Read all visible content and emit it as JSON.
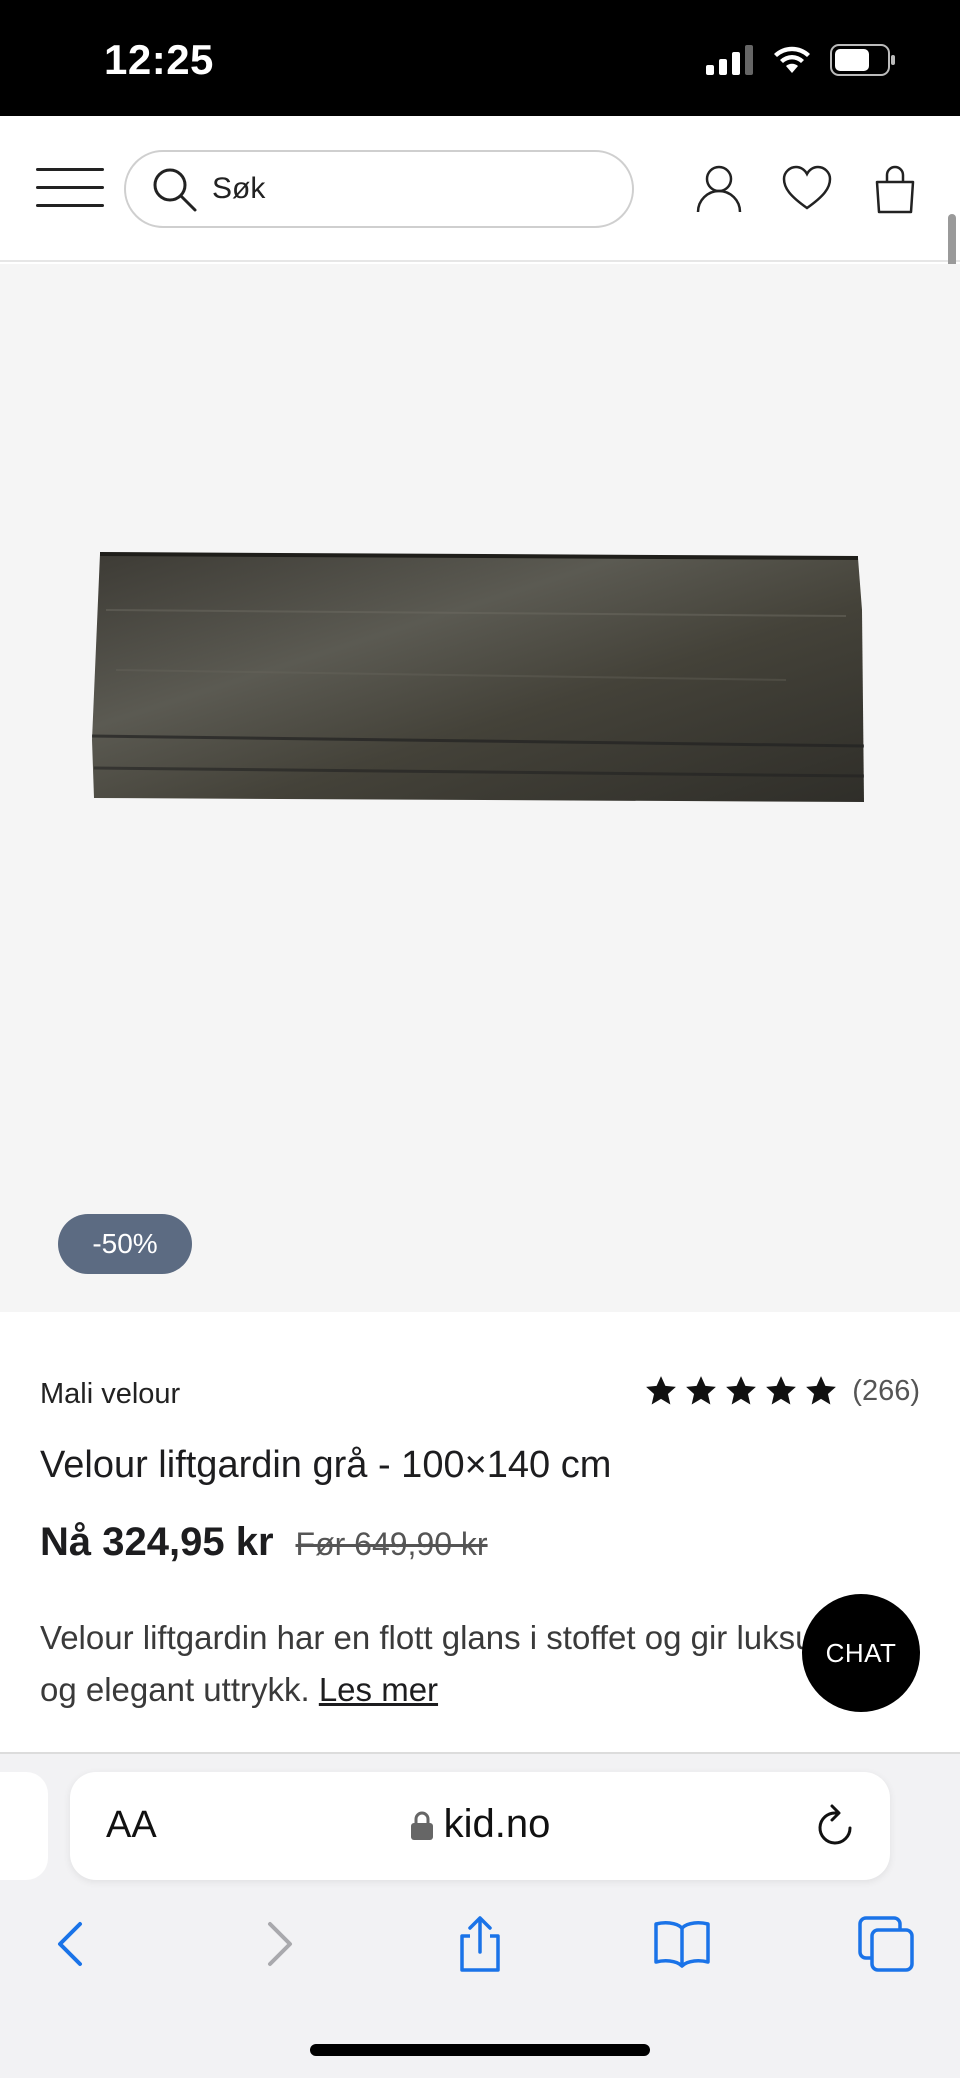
{
  "status_bar": {
    "time": "12:25"
  },
  "header": {
    "search_placeholder": "Søk",
    "icons": [
      "menu-icon",
      "search-icon",
      "account-icon",
      "heart-icon",
      "bag-icon"
    ]
  },
  "product": {
    "discount_badge": "-50%",
    "brand": "Mali velour",
    "rating": {
      "stars": 5,
      "count": "(266)"
    },
    "title": "Velour liftgardin grå - 100×140 cm",
    "price_now": "Nå 324,95 kr",
    "price_before": "Før 649,90 kr",
    "description": "Velour liftgardin har en flott glans i stoffet og gir luksuriøst og elegant uttrykk.",
    "read_more": "Les mer"
  },
  "chat": {
    "label": "CHAT"
  },
  "browser": {
    "text_size_label": "AA",
    "url": "kid.no",
    "toolbar_icons": [
      "back-icon",
      "forward-icon",
      "share-icon",
      "bookmarks-icon",
      "tabs-icon"
    ]
  },
  "colors": {
    "badge": "#5c6b82",
    "accent_ios": "#1a73e8",
    "chat": "#000000"
  }
}
